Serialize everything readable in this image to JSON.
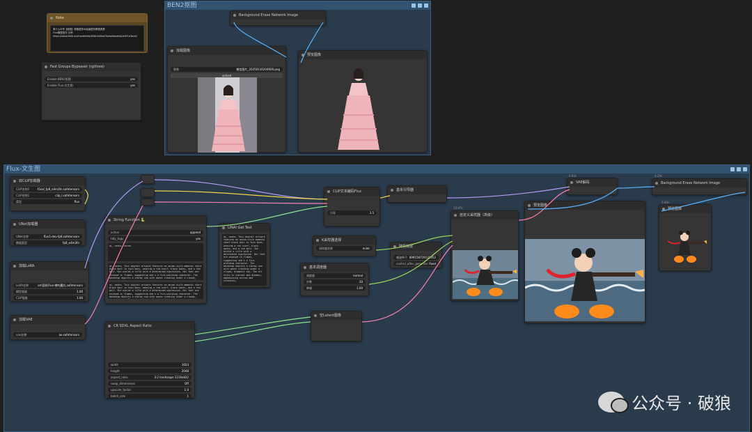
{
  "note": {
    "title": "Note",
    "lines": [
      "简介公众号【破狼】获取更多AI绘画进阶教程资源",
      "Flux模型官方-分享",
      "https://www.liblib.art/modelinfo/488c5d4ba09a4a4bbde0a2e4f1e3bcd1"
    ]
  },
  "bypasser": {
    "title": "Fast Groups Bypasser (rgthree)",
    "rows": [
      {
        "label": "Enable BEN2抠图",
        "value": "yes"
      },
      {
        "label": "Enable Flux-文生图",
        "value": "yes"
      }
    ]
  },
  "ben2_group": {
    "title": "BEN2抠图"
  },
  "bg_erase_top": {
    "title": "Background Erase Network Image"
  },
  "load_image": {
    "title": "加载图像",
    "image_label": "图像",
    "image_value": "微信图片_20250116204926.png",
    "upload_label": "upload"
  },
  "preview_top": {
    "title": "预览图像"
  },
  "flux_group": {
    "title": "Flux-文生图"
  },
  "dual_clip": {
    "title": "双CLIP加载器",
    "rows": [
      {
        "label": "CLIP名称1",
        "value": "t5xxl_fp8_e4m3fn.safetensors"
      },
      {
        "label": "CLIP名称2",
        "value": "clip_l.safetensors"
      },
      {
        "label": "类型",
        "value": "flux"
      }
    ]
  },
  "unet": {
    "title": "UNet加载器",
    "rows": [
      {
        "label": "UNet名称",
        "value": "flux1-dev-fp8.safetensors"
      },
      {
        "label": "数据类型",
        "value": "fp8_e4m3fn"
      }
    ]
  },
  "lora": {
    "title": "加载LoRA",
    "rows": [
      {
        "label": "LoRA名称",
        "value": "ssl\\国风Flux-哪吒魔丸.safetensors"
      },
      {
        "label": "模型强度",
        "value": "1.00"
      },
      {
        "label": "CLIP强度",
        "value": "1.00"
      }
    ]
  },
  "vae": {
    "title": "加载VAE",
    "rows": [
      {
        "label": "vae名称",
        "value": "ae.safetensors"
      }
    ]
  },
  "string_fn": {
    "title": "String Function 🐍",
    "rows": [
      {
        "label": "action",
        "value": "append"
      },
      {
        "label": "tidy_tags",
        "value": "yes"
      }
    ],
    "text_a": "ai, nezha, nezha",
    "text_b": "ai, nezha, This digital artwork features an anime-style mamechi short black hair in twin buns, wearing a red scarf, black pants, and a red belt. She wields a rifle with a determined expression. Her feet are encased in flames, suggesting she's a fire-wielding character. The backdrop depicts a stormy sea with waves crashing under a cloudy, dramatic sky.",
    "text_c": "ai, nezha, This digital artwork features an anime-style mamechi short black hair in twin buns, wearing a red scarf, black pants, and a red belt. She wields a rifle with a determined expression. Her feet are encased in flames, suggesting she's a fire-wielding character. The backdrop depicts a stormy sea with waves crashing under a cloudy, dramatic sky. The art style is vibrant and dynamic."
  },
  "show_text": {
    "title": "LINAI Get Text",
    "text": "ai, nezha, This digital artwork features an anime-style mamechi short black hair in twin buns, wearing a red scarf, black pants, and a red belt. She wields a rifle with a determined expression. Her feet are encased in flames, suggesting she's a fire-wielding character. The backdrop depicts a stormy sea with waves crashing under a cloudy, dramatic sky. The art style is vibrant and dynamic, emphasizing action and intensity."
  },
  "clip_encode": {
    "title": "CLIP文本编码Flux",
    "rows": [
      {
        "label": "引导",
        "value": "3.5"
      }
    ]
  },
  "basic_guider": {
    "title": "基本引导器"
  },
  "sampler_select": {
    "title": "K采样器选择",
    "rows": [
      {
        "label": "采样器名称",
        "value": "euler"
      }
    ]
  },
  "scheduler": {
    "title": "基本调度器",
    "rows": [
      {
        "label": "调度器",
        "value": "normal"
      },
      {
        "label": "步数",
        "value": "30"
      },
      {
        "label": "降噪",
        "value": "1.00"
      }
    ]
  },
  "random_noise": {
    "title": "随机噪波",
    "rows": [
      {
        "label": "噪波种子",
        "value": "899158719131352"
      },
      {
        "label": "control_after_generate",
        "value": "fixed"
      }
    ]
  },
  "custom_sampler": {
    "title": "自定义采样器（高级）",
    "time": "13.07s"
  },
  "aspect": {
    "title": "CR SDXL Aspect Ratio",
    "rows": [
      {
        "label": "width",
        "value": "1024"
      },
      {
        "label": "height",
        "value": "2048"
      },
      {
        "label": "aspect_ratio",
        "value": "3:2 landscape 1216x832"
      },
      {
        "label": "swap_dimensions",
        "value": "Off"
      },
      {
        "label": "upscale_factor",
        "value": "1.0"
      },
      {
        "label": "batch_size",
        "value": "1"
      }
    ]
  },
  "empty_latent": {
    "title": "空Latent图像"
  },
  "vae_decode": {
    "title": "VAE解码",
    "time": "0.93s"
  },
  "preview_main": {
    "title": "预览图像"
  },
  "bg_erase_bottom": {
    "title": "Background Erase Network Image",
    "time": "4.29s"
  },
  "preview_right": {
    "title": "预览图像",
    "time": "0.40s"
  },
  "watermark": {
    "text": "公众号 · 破狼"
  },
  "colors": {
    "wire_blue": "#58b4ff",
    "wire_yellow": "#f5d54a",
    "wire_pink": "#ff7eb3",
    "wire_green": "#8fe38f",
    "wire_lime": "#9cd65b",
    "group_blue": "#3a5f80"
  }
}
